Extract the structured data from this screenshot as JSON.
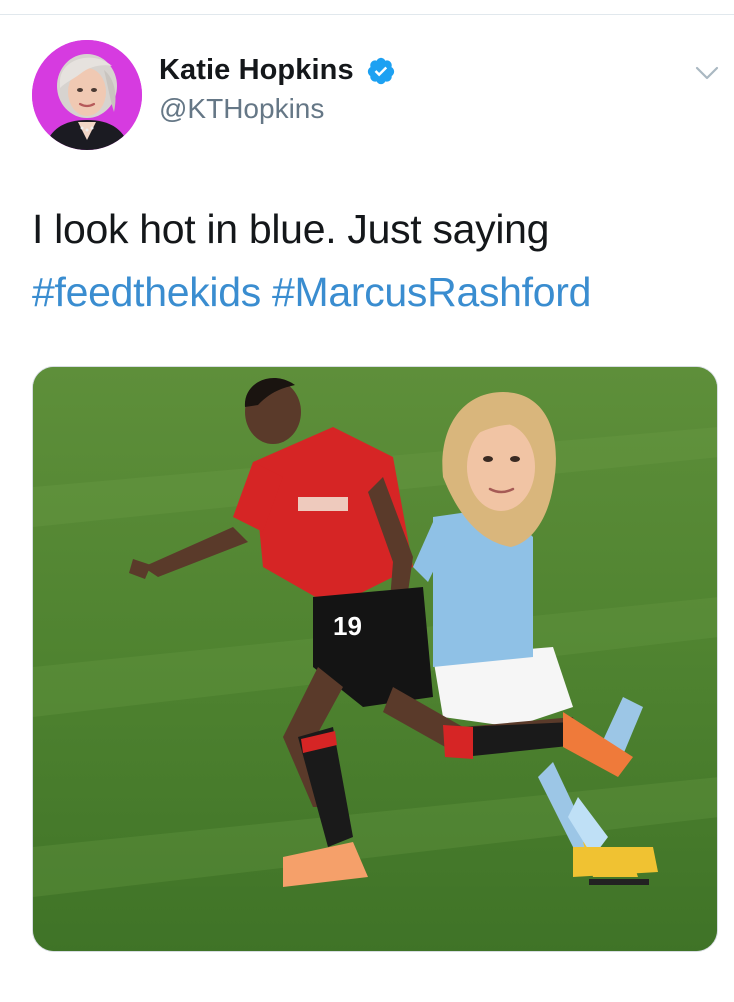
{
  "tweet": {
    "author": {
      "name": "Katie Hopkins",
      "handle": "@KTHopkins",
      "verified": true,
      "avatar_bg": "#d63be0"
    },
    "text": "I look hot in blue. Just saying",
    "hashtags": [
      "#feedthekids",
      "#MarcusRashford"
    ],
    "media": {
      "kind": "photo",
      "kit_number": "19"
    }
  },
  "colors": {
    "verified_badge": "#1da1f2",
    "hashtag": "#3a8dd0",
    "handle": "#657786"
  },
  "icons": {
    "verified": "verified-badge-icon",
    "menu": "chevron-down-icon"
  }
}
